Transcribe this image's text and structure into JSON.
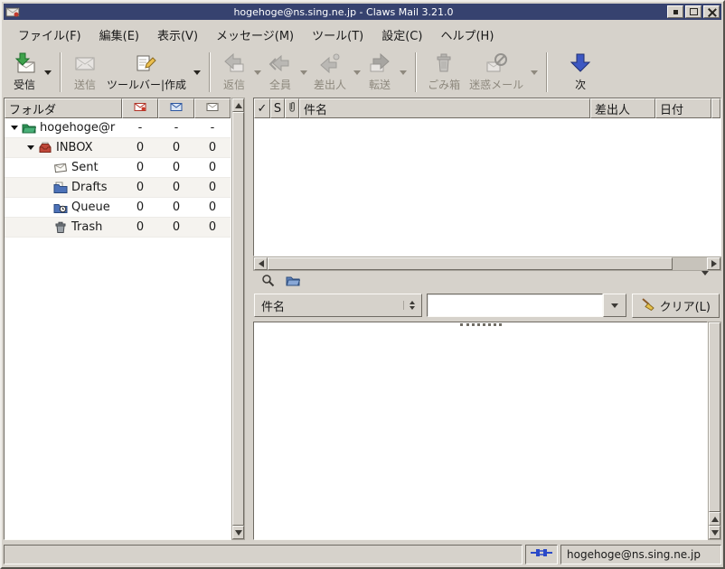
{
  "window": {
    "title": "hogehoge@ns.sing.ne.jp - Claws Mail 3.21.0"
  },
  "menubar": {
    "items": [
      {
        "label": "ファイル(F)"
      },
      {
        "label": "編集(E)"
      },
      {
        "label": "表示(V)"
      },
      {
        "label": "メッセージ(M)"
      },
      {
        "label": "ツール(T)"
      },
      {
        "label": "設定(C)"
      },
      {
        "label": "ヘルプ(H)"
      }
    ]
  },
  "toolbar": {
    "items": [
      {
        "label": "受信",
        "enabled": true,
        "dropdown": true
      },
      {
        "label": "送信",
        "enabled": false,
        "dropdown": false
      },
      {
        "label": "ツールバー|作成",
        "enabled": true,
        "dropdown": true
      },
      {
        "label": "返信",
        "enabled": false,
        "dropdown": true
      },
      {
        "label": "全員",
        "enabled": false,
        "dropdown": true
      },
      {
        "label": "差出人",
        "enabled": false,
        "dropdown": true
      },
      {
        "label": "転送",
        "enabled": false,
        "dropdown": true
      },
      {
        "label": "ごみ箱",
        "enabled": false,
        "dropdown": false
      },
      {
        "label": "迷惑メール",
        "enabled": false,
        "dropdown": true
      },
      {
        "label": "次",
        "enabled": true,
        "dropdown": false
      }
    ]
  },
  "folder_pane": {
    "header_title": "フォルダ",
    "rows": [
      {
        "name": "hogehoge@r",
        "new": "-",
        "unread": "-",
        "total": "-"
      },
      {
        "name": "INBOX",
        "new": "0",
        "unread": "0",
        "total": "0"
      },
      {
        "name": "Sent",
        "new": "0",
        "unread": "0",
        "total": "0"
      },
      {
        "name": "Drafts",
        "new": "0",
        "unread": "0",
        "total": "0"
      },
      {
        "name": "Queue",
        "new": "0",
        "unread": "0",
        "total": "0"
      },
      {
        "name": "Trash",
        "new": "0",
        "unread": "0",
        "total": "0"
      }
    ]
  },
  "message_list": {
    "columns": {
      "mark": "✓",
      "status": "S",
      "subject": "件名",
      "from": "差出人",
      "date": "日付"
    },
    "rows": []
  },
  "quicksearch": {
    "search_type": "件名",
    "entry_value": "",
    "clear_label": "クリア(L)"
  },
  "statusbar": {
    "account": "hogehoge@ns.sing.ne.jp"
  },
  "appearance": {
    "titlebar_color": "#36426f",
    "window_bg": "#d6d2cb",
    "disabled_text": "#8e897e",
    "accent_green": "#3fa24b",
    "accent_blue": "#3c57c2"
  },
  "icons": {
    "app-icon": "envelope-red-dot",
    "receive-mail-icon": "envelope + green down arrow",
    "send-mail-icon": "envelope",
    "compose-icon": "sheet + pencil",
    "reply-icon": "orange left arrow + envelope",
    "reply-all-icon": "double orange left arrow + envelope",
    "reply-sender-icon": "orange left arrow + person",
    "forward-icon": "blue right arrow + envelope",
    "trash-icon": "trash can",
    "spam-icon": "envelope + red no-sign",
    "next-unread-icon": "blue down arrow",
    "new-count-icon": "red envelope",
    "unread-count-icon": "blue envelope",
    "total-count-icon": "gray envelope",
    "account-folder-icon": "green open folder",
    "inbox-icon": "red inbox tray",
    "sent-icon": "tilted white envelope",
    "drafts-icon": "blue folder + paper",
    "queue-icon": "blue folder + clock",
    "trash-folder-icon": "small trash can",
    "attachment-icon": "paperclip",
    "magnifier-icon": "magnifying glass",
    "search-folder-icon": "blue open folder",
    "clear-icon": "yellow broom",
    "network-status-icon": "blue plug connector"
  }
}
